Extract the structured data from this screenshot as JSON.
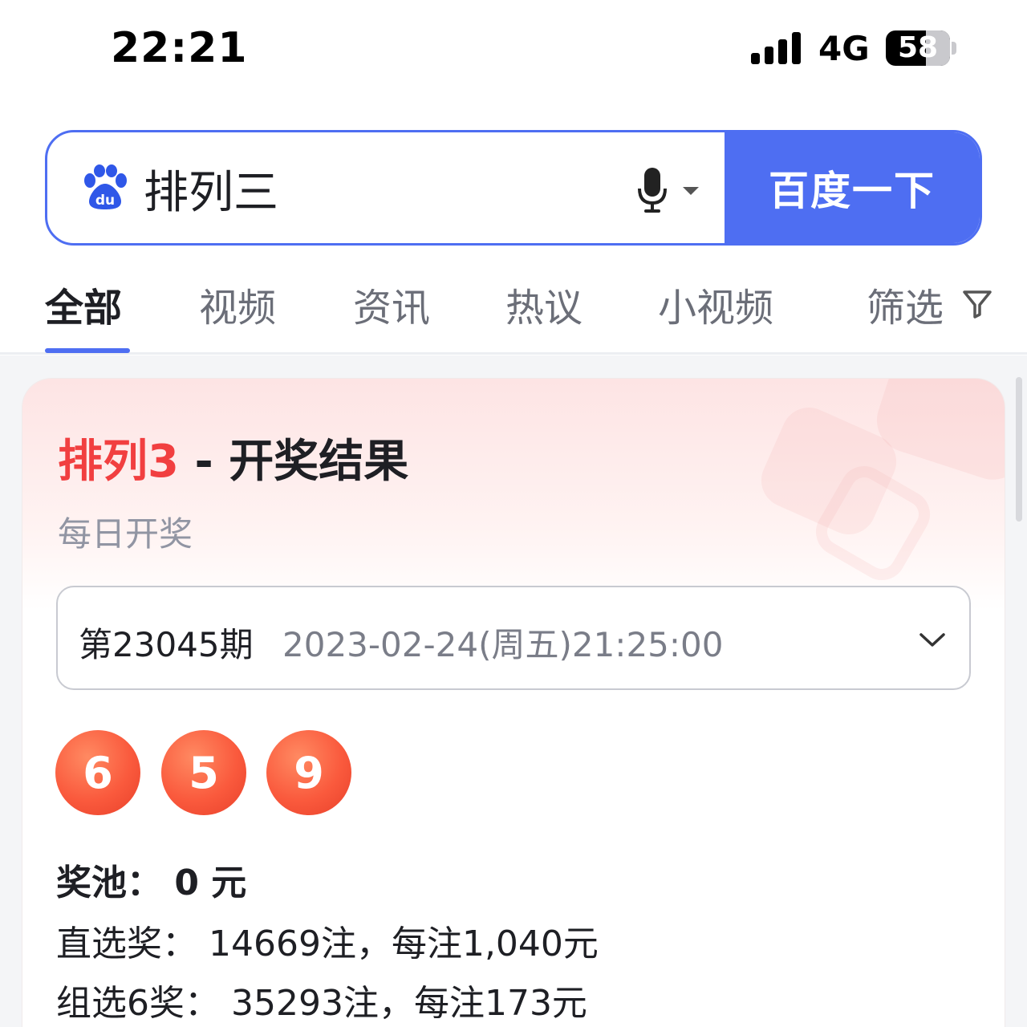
{
  "status_bar": {
    "time": "22:21",
    "network": "4G",
    "battery": "58"
  },
  "search": {
    "query": "排列三",
    "button_label": "百度一下",
    "accent_color": "#4e6ef2"
  },
  "tabs": [
    {
      "label": "全部",
      "active": true
    },
    {
      "label": "视频",
      "active": false
    },
    {
      "label": "资讯",
      "active": false
    },
    {
      "label": "热议",
      "active": false
    },
    {
      "label": "小视频",
      "active": false
    },
    {
      "label": "筛选",
      "active": false
    }
  ],
  "card": {
    "title_highlight": "排列3",
    "title_rest": " - 开奖结果",
    "subtitle": "每日开奖",
    "issue": "第23045期",
    "date": "2023-02-24(周五)21:25:00",
    "numbers": [
      "6",
      "5",
      "9"
    ],
    "pool": "奖池：  0 元",
    "prize_direct": "直选奖：  14669注，每注1,040元",
    "prize_group6": "组选6奖：  35293注，每注173元",
    "highlight_color": "#f13f40"
  }
}
